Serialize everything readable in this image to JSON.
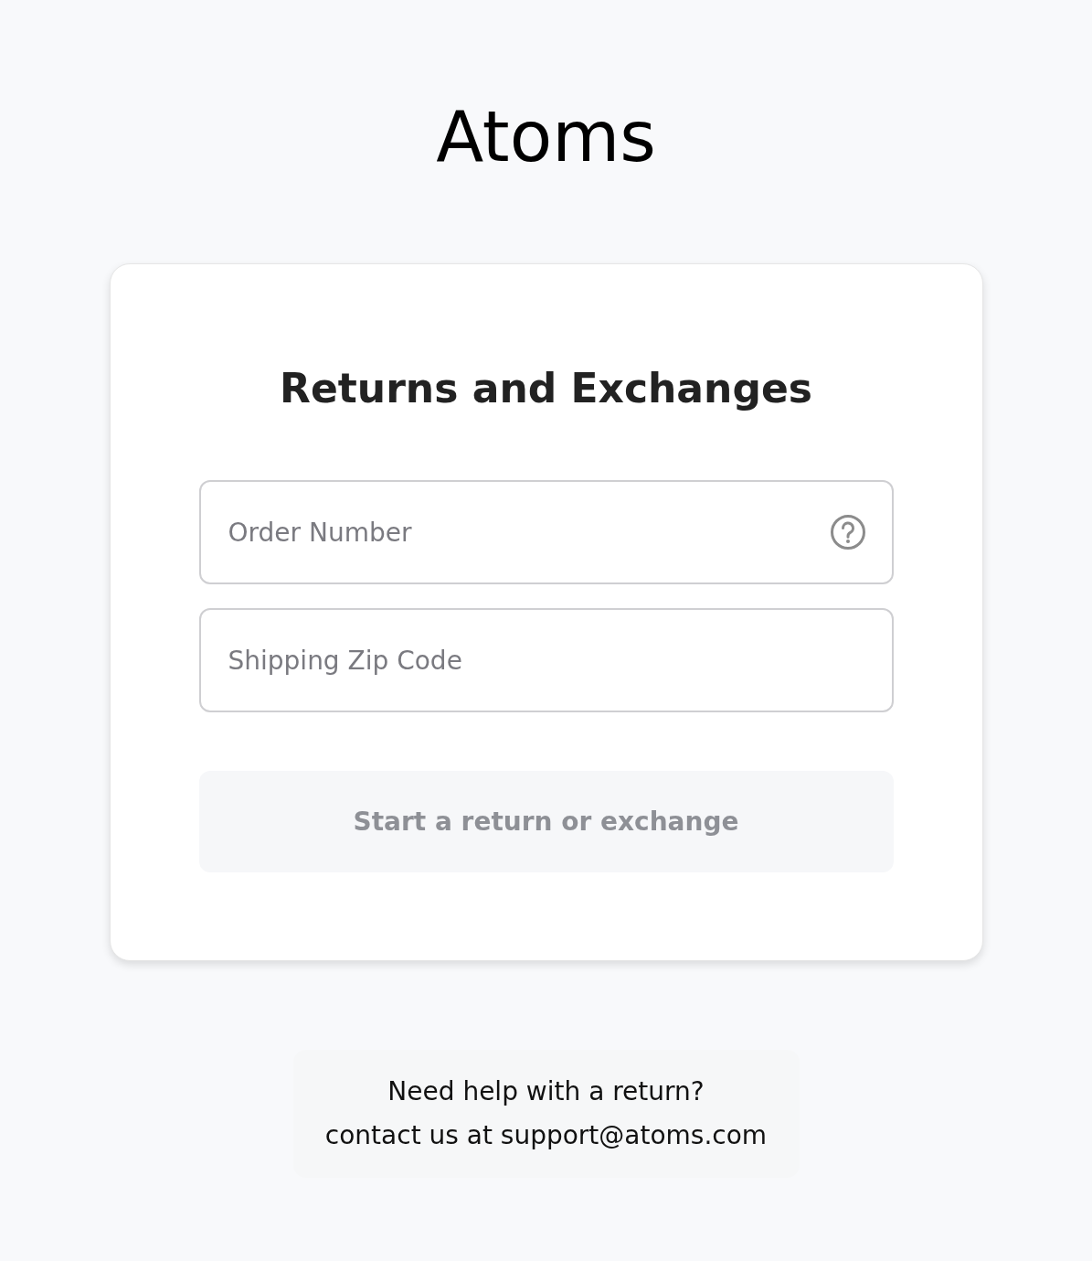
{
  "brand": "Atoms",
  "card": {
    "title": "Returns and Exchanges",
    "fields": [
      {
        "placeholder": "Order Number",
        "help": true
      },
      {
        "placeholder": "Shipping Zip Code",
        "help": false
      }
    ],
    "button": {
      "label": "Start a return or exchange",
      "disabled": true
    }
  },
  "help": {
    "lines": [
      "Need help with a return?",
      "contact us at support@atoms.com"
    ]
  }
}
